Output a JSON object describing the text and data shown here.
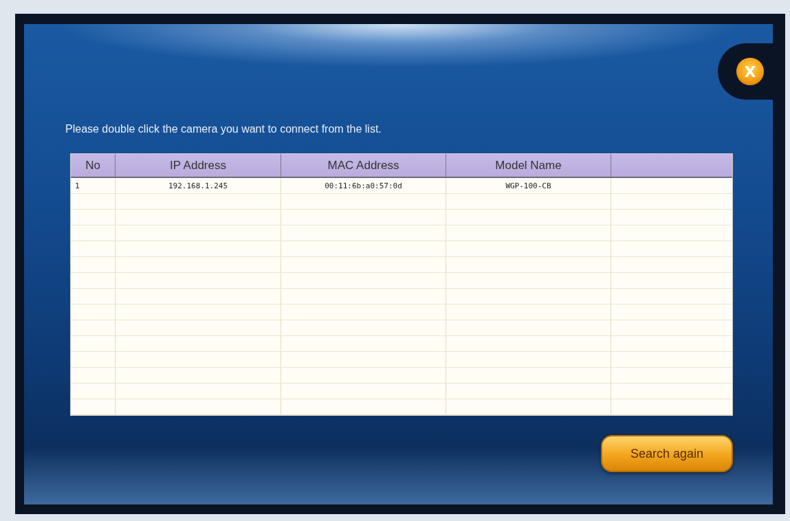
{
  "close_button": {
    "label": "X"
  },
  "instruction": "Please double click the camera you want to connect from the list.",
  "table": {
    "columns": [
      "No",
      "IP Address",
      "MAC Address",
      "Model Name"
    ],
    "rows": [
      {
        "cells": [
          "1",
          "192.168.1.245",
          "00:11:6b:a0:57:0d",
          "WGP-100-CB"
        ]
      }
    ]
  },
  "buttons": [
    {
      "label": "Search again"
    }
  ]
}
